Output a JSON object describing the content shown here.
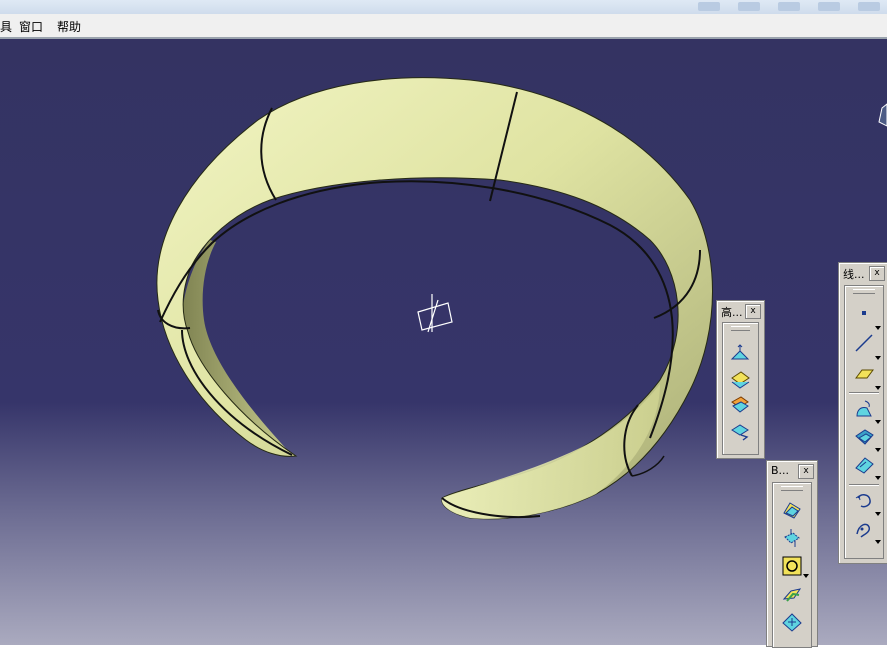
{
  "menu": {
    "items": [
      {
        "label": "具"
      },
      {
        "label": "窗口"
      },
      {
        "label": "帮助"
      }
    ]
  },
  "toolbars": {
    "advanced_surfaces": {
      "title": "高...",
      "close": "x",
      "icons": [
        "bump-surface-icon",
        "wrap-curve-icon",
        "wrap-surface-icon",
        "shape-morphing-icon"
      ]
    },
    "bi_toolbar": {
      "title": "B...",
      "close": "x",
      "icons": [
        "fill-surface-icon",
        "blend-icon",
        "circle-icon",
        "multi-section-icon",
        "extrude-icon"
      ]
    },
    "wireframe": {
      "title": "线...",
      "close": "x",
      "icons": [
        "point-icon",
        "line-icon",
        "plane-icon",
        "sweep-icon",
        "offset-surface-icon",
        "fill-icon",
        "curve-icon",
        "spline-icon"
      ]
    }
  },
  "colors": {
    "background_top": "#343362",
    "background_bottom": "#aaaabf",
    "model_surface": "#e3e8a6",
    "model_shadow": "#8d9060",
    "edge": "#111111"
  }
}
